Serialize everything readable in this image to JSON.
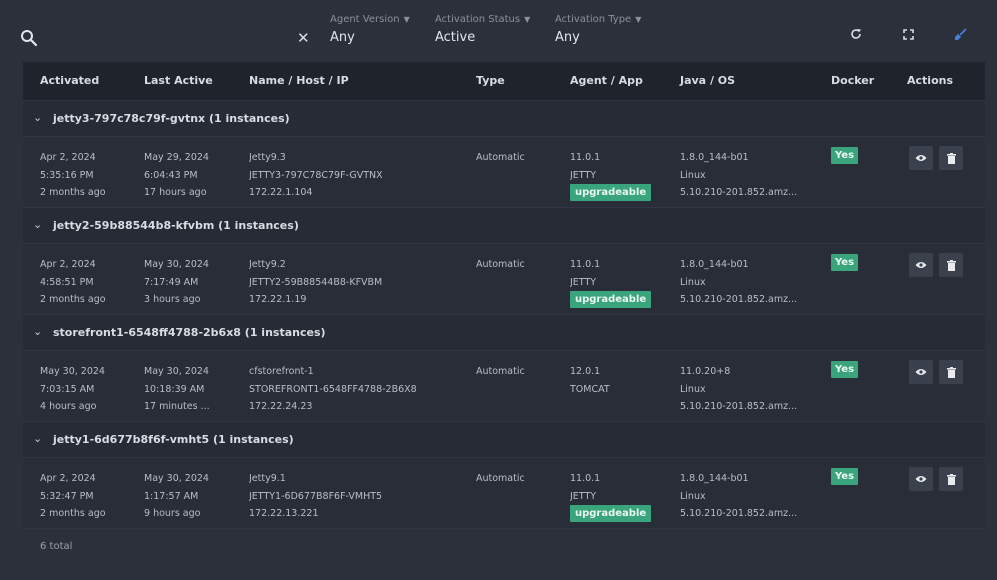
{
  "filters": {
    "search_value": "",
    "agent_version": {
      "label": "Agent Version",
      "value": "Any"
    },
    "activation_status": {
      "label": "Activation Status",
      "value": "Active"
    },
    "activation_type": {
      "label": "Activation Type",
      "value": "Any"
    }
  },
  "toolbar": {
    "icons": [
      "refresh-icon",
      "expand-icon",
      "broom-icon"
    ],
    "accent": "#4a7fd6"
  },
  "columns": [
    "Activated",
    "Last Active",
    "Name / Host / IP",
    "Type",
    "Agent / App",
    "Java / OS",
    "Docker",
    "Actions"
  ],
  "groups": [
    {
      "title": "jetty3-797c78c79f-gvtnx (1 instances)",
      "row": {
        "activated": [
          "Apr 2, 2024",
          "5:35:16 PM",
          "2 months ago"
        ],
        "last_active": [
          "May 29, 2024",
          "6:04:43 PM",
          "17 hours ago"
        ],
        "name_host_ip": [
          "Jetty9.3",
          "JETTY3-797C78C79F-GVTNX",
          "172.22.1.104"
        ],
        "type": "Automatic",
        "agent_app": [
          "11.0.1",
          "JETTY"
        ],
        "badge": "upgradeable",
        "java_os": [
          "1.8.0_144-b01",
          "Linux",
          "5.10.210-201.852.amz..."
        ],
        "docker": "Yes"
      }
    },
    {
      "title": "jetty2-59b88544b8-kfvbm (1 instances)",
      "row": {
        "activated": [
          "Apr 2, 2024",
          "4:58:51 PM",
          "2 months ago"
        ],
        "last_active": [
          "May 30, 2024",
          "7:17:49 AM",
          "3 hours ago"
        ],
        "name_host_ip": [
          "Jetty9.2",
          "JETTY2-59B88544B8-KFVBM",
          "172.22.1.19"
        ],
        "type": "Automatic",
        "agent_app": [
          "11.0.1",
          "JETTY"
        ],
        "badge": "upgradeable",
        "java_os": [
          "1.8.0_144-b01",
          "Linux",
          "5.10.210-201.852.amz..."
        ],
        "docker": "Yes"
      }
    },
    {
      "title": "storefront1-6548ff4788-2b6x8 (1 instances)",
      "row": {
        "activated": [
          "May 30, 2024",
          "7:03:15 AM",
          "4 hours ago"
        ],
        "last_active": [
          "May 30, 2024",
          "10:18:39 AM",
          "17 minutes ..."
        ],
        "name_host_ip": [
          "cfstorefront-1",
          "STOREFRONT1-6548FF4788-2B6X8",
          "172.22.24.23"
        ],
        "type": "Automatic",
        "agent_app": [
          "12.0.1",
          "TOMCAT"
        ],
        "badge": "",
        "java_os": [
          "11.0.20+8",
          "Linux",
          "5.10.210-201.852.amz..."
        ],
        "docker": "Yes"
      }
    },
    {
      "title": "jetty1-6d677b8f6f-vmht5 (1 instances)",
      "row": {
        "activated": [
          "Apr 2, 2024",
          "5:32:47 PM",
          "2 months ago"
        ],
        "last_active": [
          "May 30, 2024",
          "1:17:57 AM",
          "9 hours ago"
        ],
        "name_host_ip": [
          "Jetty9.1",
          "JETTY1-6D677B8F6F-VMHT5",
          "172.22.13.221"
        ],
        "type": "Automatic",
        "agent_app": [
          "11.0.1",
          "JETTY"
        ],
        "badge": "upgradeable",
        "java_os": [
          "1.8.0_144-b01",
          "Linux",
          "5.10.210-201.852.amz..."
        ],
        "docker": "Yes"
      }
    }
  ],
  "footer": {
    "total": "6 total"
  },
  "colors": {
    "success": "#3aa57c",
    "background": "#2b303b",
    "header": "#1f232b"
  }
}
